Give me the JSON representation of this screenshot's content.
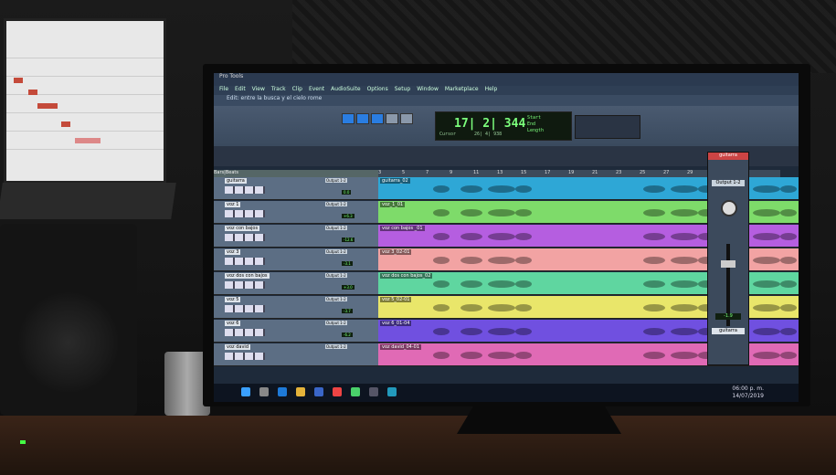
{
  "window": {
    "title": "Pro Tools"
  },
  "menus": [
    "File",
    "Edit",
    "View",
    "Track",
    "Clip",
    "Event",
    "AudioSuite",
    "Options",
    "Setup",
    "Window",
    "Marketplace",
    "Help"
  ],
  "edit_window": {
    "title": "Edit: entre la busca y el cielo rome"
  },
  "counter": {
    "main": "17| 2| 344",
    "cursor_label": "Cursor",
    "cursor_value": "26| 4| 938",
    "start": "Start",
    "end": "End",
    "length": "Length"
  },
  "ruler_marks": [
    "3",
    "5",
    "7",
    "9",
    "11",
    "13",
    "15",
    "17",
    "19",
    "21",
    "23",
    "25",
    "27",
    "29"
  ],
  "tracks_header": "Bars|Beats",
  "tracks": [
    {
      "name": "guitarra",
      "io": "Output 1-2",
      "vol": "0.0",
      "clip": "guitarra_02",
      "color": "#2ea7d6"
    },
    {
      "name": "voz 1",
      "io": "Output 1-2",
      "vol": "+6.3",
      "clip": "voz_1_01",
      "color": "#7edb6a"
    },
    {
      "name": "voz con bajos",
      "io": "Output 1-2",
      "vol": "-12.6",
      "clip": "voz con bajos _01",
      "color": "#b55ee0"
    },
    {
      "name": "voz 3",
      "io": "Output 1-2",
      "vol": "-3.1",
      "clip": "voz 3_02-01",
      "color": "#f2a3a3"
    },
    {
      "name": "voz dos con bajos",
      "io": "Output 1-2",
      "vol": "+3.0",
      "clip": "voz dos con bajos_02",
      "color": "#5fd6a0"
    },
    {
      "name": "voz 5",
      "io": "Output 1-2",
      "vol": "-3.7",
      "clip": "voz 5_02-01",
      "color": "#e9e66a"
    },
    {
      "name": "voz 6",
      "io": "Output 1-2",
      "vol": "-6.2",
      "clip": "voz 6_01-04",
      "color": "#7050e0"
    },
    {
      "name": "voz david",
      "io": "Output 1-2",
      "vol": "",
      "clip": "voz david_04-01",
      "color": "#e06ab5"
    }
  ],
  "mix": {
    "title": "guitarra",
    "out": "Output 1-2",
    "vol": "-1.9",
    "track": "guitarra"
  },
  "taskbar": {
    "time": "06:00 p. m.",
    "date": "14/07/2019"
  },
  "colors": {
    "accent": "#2a7de1",
    "counter": "#7cff7c"
  }
}
